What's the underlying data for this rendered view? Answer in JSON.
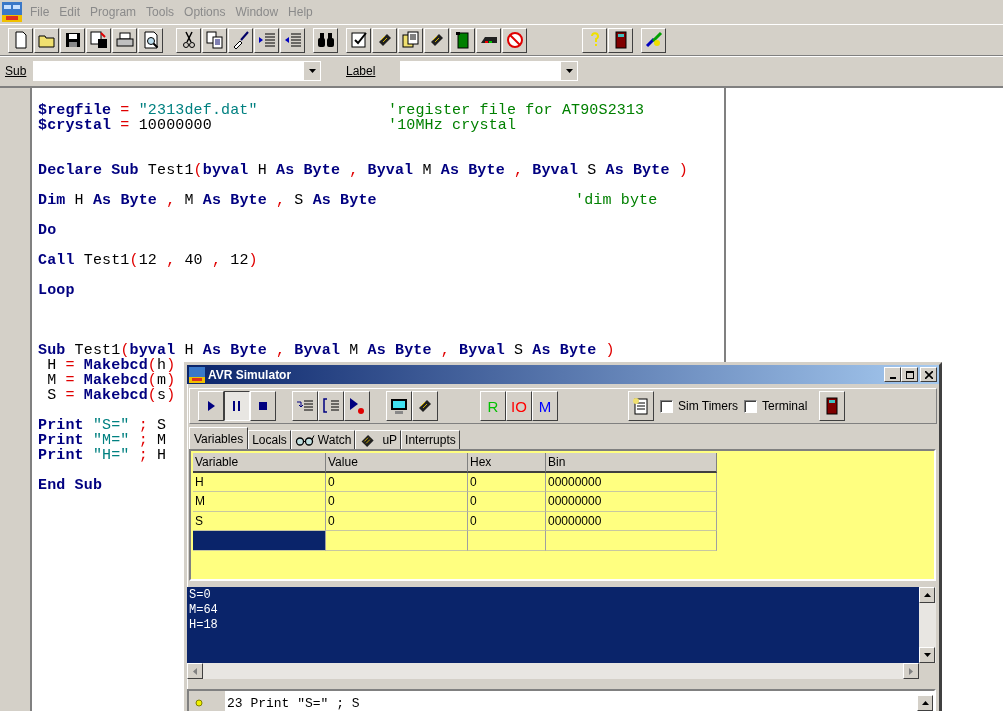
{
  "menu": [
    "File",
    "Edit",
    "Program",
    "Tools",
    "Options",
    "Window",
    "Help"
  ],
  "combos": [
    {
      "label": "Sub"
    },
    {
      "label": "Label"
    }
  ],
  "code_lines": [
    {
      "kind": "directive",
      "tokens": [
        {
          "kind": "kw",
          "text": "$regfile"
        },
        {
          "kind": "op",
          "text": " = "
        },
        {
          "kind": "str",
          "text": "\"2313def.dat\""
        }
      ],
      "comment": "'register file for AT90S2313"
    },
    {
      "kind": "directive",
      "tokens": [
        {
          "kind": "kw",
          "text": "$crystal"
        },
        {
          "kind": "op",
          "text": " = "
        },
        {
          "kind": "num",
          "text": "10000000"
        }
      ],
      "comment": "'10MHz crystal"
    },
    {
      "kind": "blank"
    },
    {
      "kind": "blank"
    },
    {
      "kind": "code",
      "tokens": [
        {
          "kind": "kw",
          "text": "Declare Sub"
        },
        {
          "kind": "id",
          "text": " Test1"
        },
        {
          "kind": "op",
          "text": "("
        },
        {
          "kind": "kw",
          "text": "byval"
        },
        {
          "kind": "id",
          "text": " H "
        },
        {
          "kind": "kw",
          "text": "As Byte"
        },
        {
          "kind": "op",
          "text": " , "
        },
        {
          "kind": "kw",
          "text": "Byval"
        },
        {
          "kind": "id",
          "text": " M "
        },
        {
          "kind": "kw",
          "text": "As Byte"
        },
        {
          "kind": "op",
          "text": " , "
        },
        {
          "kind": "kw",
          "text": "Byval"
        },
        {
          "kind": "id",
          "text": " S "
        },
        {
          "kind": "kw",
          "text": "As Byte"
        },
        {
          "kind": "op",
          "text": " )"
        }
      ]
    },
    {
      "kind": "blank"
    },
    {
      "kind": "statement",
      "tokens": [
        {
          "kind": "kw",
          "text": "Dim"
        },
        {
          "kind": "id",
          "text": " H "
        },
        {
          "kind": "kw",
          "text": "As Byte"
        },
        {
          "kind": "op",
          "text": " , "
        },
        {
          "kind": "id",
          "text": "M "
        },
        {
          "kind": "kw",
          "text": "As Byte"
        },
        {
          "kind": "op",
          "text": " , "
        },
        {
          "kind": "id",
          "text": "S "
        },
        {
          "kind": "kw",
          "text": "As Byte"
        }
      ],
      "comment": "'dim byte"
    },
    {
      "kind": "blank"
    },
    {
      "kind": "code",
      "tokens": [
        {
          "kind": "kw",
          "text": "Do"
        }
      ]
    },
    {
      "kind": "blank"
    },
    {
      "kind": "code",
      "tokens": [
        {
          "kind": "kw",
          "text": "Call"
        },
        {
          "kind": "id",
          "text": " Test1"
        },
        {
          "kind": "op",
          "text": "("
        },
        {
          "kind": "num",
          "text": "12"
        },
        {
          "kind": "op",
          "text": " , "
        },
        {
          "kind": "num",
          "text": "40"
        },
        {
          "kind": "op",
          "text": " , "
        },
        {
          "kind": "num",
          "text": "12"
        },
        {
          "kind": "op",
          "text": ")"
        }
      ]
    },
    {
      "kind": "blank"
    },
    {
      "kind": "code",
      "tokens": [
        {
          "kind": "kw",
          "text": "Loop"
        }
      ]
    },
    {
      "kind": "blank"
    },
    {
      "kind": "blank"
    },
    {
      "kind": "blank"
    },
    {
      "kind": "code",
      "tokens": [
        {
          "kind": "kw",
          "text": "Sub"
        },
        {
          "kind": "id",
          "text": " Test1"
        },
        {
          "kind": "op",
          "text": "("
        },
        {
          "kind": "kw",
          "text": "byval"
        },
        {
          "kind": "id",
          "text": " H "
        },
        {
          "kind": "kw",
          "text": "As Byte"
        },
        {
          "kind": "op",
          "text": " , "
        },
        {
          "kind": "kw",
          "text": "Byval"
        },
        {
          "kind": "id",
          "text": " M "
        },
        {
          "kind": "kw",
          "text": "As Byte"
        },
        {
          "kind": "op",
          "text": " , "
        },
        {
          "kind": "kw",
          "text": "Byval"
        },
        {
          "kind": "id",
          "text": " S "
        },
        {
          "kind": "kw",
          "text": "As Byte"
        },
        {
          "kind": "op",
          "text": " )"
        }
      ]
    },
    {
      "kind": "code",
      "tokens": [
        {
          "kind": "id",
          "text": " H"
        },
        {
          "kind": "op",
          "text": " = "
        },
        {
          "kind": "kw",
          "text": "Makebcd"
        },
        {
          "kind": "op",
          "text": "("
        },
        {
          "kind": "id",
          "text": "h"
        },
        {
          "kind": "op",
          "text": ")"
        }
      ]
    },
    {
      "kind": "code",
      "tokens": [
        {
          "kind": "id",
          "text": " M"
        },
        {
          "kind": "op",
          "text": " = "
        },
        {
          "kind": "kw",
          "text": "Makebcd"
        },
        {
          "kind": "op",
          "text": "("
        },
        {
          "kind": "id",
          "text": "m"
        },
        {
          "kind": "op",
          "text": ")"
        }
      ]
    },
    {
      "kind": "code",
      "tokens": [
        {
          "kind": "id",
          "text": " S"
        },
        {
          "kind": "op",
          "text": " = "
        },
        {
          "kind": "kw",
          "text": "Makebcd"
        },
        {
          "kind": "op",
          "text": "("
        },
        {
          "kind": "id",
          "text": "s"
        },
        {
          "kind": "op",
          "text": ")"
        }
      ]
    },
    {
      "kind": "blank"
    },
    {
      "kind": "code",
      "tokens": [
        {
          "kind": "kw",
          "text": "Print"
        },
        {
          "kind": "str",
          "text": " \"S=\""
        },
        {
          "kind": "op",
          "text": " ; "
        },
        {
          "kind": "id",
          "text": "S"
        }
      ]
    },
    {
      "kind": "code",
      "tokens": [
        {
          "kind": "kw",
          "text": "Print"
        },
        {
          "kind": "str",
          "text": " \"M=\""
        },
        {
          "kind": "op",
          "text": " ; "
        },
        {
          "kind": "id",
          "text": "M"
        }
      ]
    },
    {
      "kind": "code",
      "tokens": [
        {
          "kind": "kw",
          "text": "Print"
        },
        {
          "kind": "str",
          "text": " \"H=\""
        },
        {
          "kind": "op",
          "text": " ; "
        },
        {
          "kind": "id",
          "text": "H"
        }
      ]
    },
    {
      "kind": "blank"
    },
    {
      "kind": "code",
      "tokens": [
        {
          "kind": "kw",
          "text": "End Sub"
        }
      ]
    }
  ],
  "simulator": {
    "title": "AVR Simulator",
    "register_buttons": [
      {
        "label": "R",
        "color": "#00c000"
      },
      {
        "label": "IO",
        "color": "#ff0000"
      },
      {
        "label": "M",
        "color": "#0000ff"
      }
    ],
    "checkboxes": [
      {
        "label": "Sim Timers",
        "checked": false
      },
      {
        "label": "Terminal",
        "checked": false
      }
    ],
    "tabs": [
      {
        "label": "Variables",
        "kind": "plain",
        "selected": true
      },
      {
        "label": "Locals",
        "kind": "plain",
        "selected": false
      },
      {
        "label": "Watch",
        "kind": "glasses",
        "selected": false
      },
      {
        "label": "uP",
        "kind": "chip",
        "selected": false
      },
      {
        "label": "Interrupts",
        "kind": "plain",
        "selected": false
      }
    ],
    "table": {
      "columns": [
        "Variable",
        "Value",
        "Hex",
        "Bin"
      ],
      "rows": [
        [
          "H",
          "0",
          "0",
          "00000000"
        ],
        [
          "M",
          "0",
          "0",
          "00000000"
        ],
        [
          "S",
          "0",
          "0",
          "00000000"
        ]
      ],
      "new_row": {
        "selected": true
      }
    },
    "terminal_output": [
      "S=0",
      "M=64",
      "H=18"
    ],
    "current_line": "23 Print \"S=\" ; S"
  }
}
